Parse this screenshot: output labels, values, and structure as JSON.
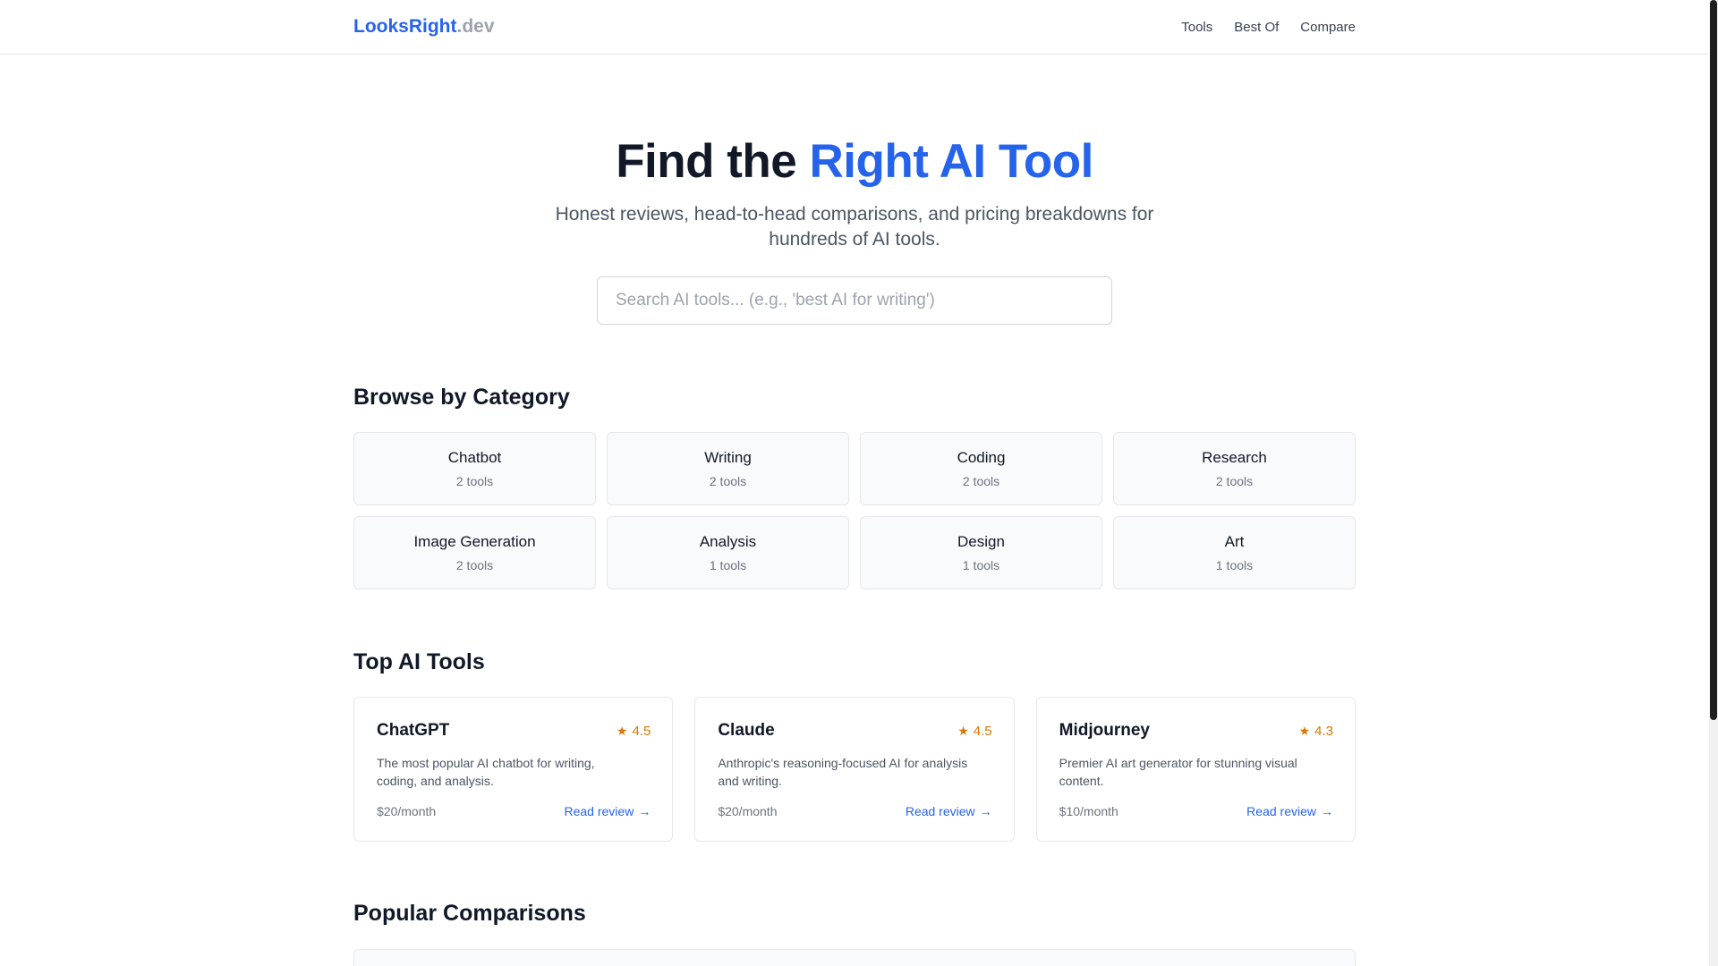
{
  "header": {
    "logo_brand": "LooksRight",
    "logo_tld": ".dev",
    "nav": [
      "Tools",
      "Best Of",
      "Compare"
    ]
  },
  "hero": {
    "title_prefix": "Find the ",
    "title_accent": "Right AI Tool",
    "subtitle": "Honest reviews, head-to-head comparisons, and pricing breakdowns for hundreds of AI tools."
  },
  "search": {
    "placeholder": "Search AI tools... (e.g., 'best AI for writing')",
    "value": ""
  },
  "categories_section": {
    "title": "Browse by Category",
    "items": [
      {
        "name": "Chatbot",
        "count": "2 tools"
      },
      {
        "name": "Writing",
        "count": "2 tools"
      },
      {
        "name": "Coding",
        "count": "2 tools"
      },
      {
        "name": "Research",
        "count": "2 tools"
      },
      {
        "name": "Image Generation",
        "count": "2 tools"
      },
      {
        "name": "Analysis",
        "count": "1 tools"
      },
      {
        "name": "Design",
        "count": "1 tools"
      },
      {
        "name": "Art",
        "count": "1 tools"
      }
    ]
  },
  "tools_section": {
    "title": "Top AI Tools",
    "items": [
      {
        "name": "ChatGPT",
        "rating": "4.5",
        "description": "The most popular AI chatbot for writing, coding, and analysis.",
        "price": "$20/month",
        "link": "Read review"
      },
      {
        "name": "Claude",
        "rating": "4.5",
        "description": "Anthropic's reasoning-focused AI for analysis and writing.",
        "price": "$20/month",
        "link": "Read review"
      },
      {
        "name": "Midjourney",
        "rating": "4.3",
        "description": "Premier AI art generator for stunning visual content.",
        "price": "$10/month",
        "link": "Read review"
      }
    ]
  },
  "comparisons_section": {
    "title": "Popular Comparisons"
  },
  "icons": {
    "star": "★",
    "arrow": "→"
  },
  "colors": {
    "accent": "#2563eb",
    "rating": "#d97706",
    "muted": "#9ca3af"
  }
}
